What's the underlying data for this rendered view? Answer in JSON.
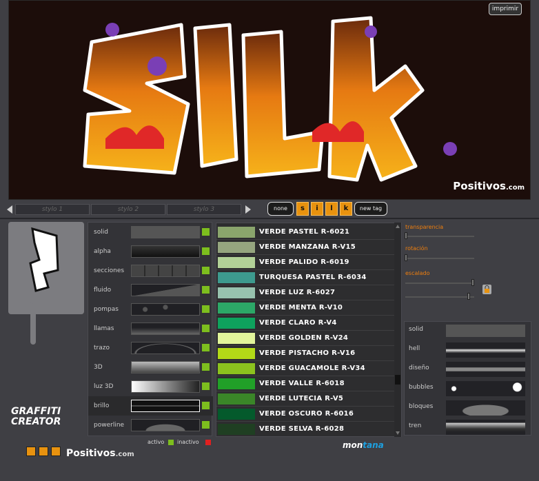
{
  "canvas": {
    "print_label": "imprimir",
    "watermark": "Positivos",
    "watermark_suffix": ".com"
  },
  "style_bar": {
    "slots": [
      "stylo 1",
      "stylo 2",
      "stylo 3"
    ],
    "none_label": "none",
    "letters": [
      "s",
      "i",
      "l",
      "k"
    ],
    "new_tag_label": "new tag"
  },
  "effects": {
    "items": [
      "solid",
      "alpha",
      "secciones",
      "fluido",
      "pompas",
      "llamas",
      "trazo",
      "3D",
      "luz 3D",
      "brillo",
      "powerline"
    ],
    "legend_active": "activo",
    "legend_inactive": "inactivo",
    "active_color": "#7dbe1e",
    "inactive_color": "#e02020"
  },
  "colors": {
    "items": [
      {
        "name": "VERDE PASTEL R-6021",
        "hex": "#8aa56c"
      },
      {
        "name": "VERDE MANZANA R-V15",
        "hex": "#95a57f"
      },
      {
        "name": "VERDE PALIDO R-6019",
        "hex": "#b2d197"
      },
      {
        "name": "TURQUESA PASTEL R-6034",
        "hex": "#3d9a8e"
      },
      {
        "name": "VERDE LUZ R-6027",
        "hex": "#97c2ae"
      },
      {
        "name": "VERDE MENTA R-V10",
        "hex": "#2ca867"
      },
      {
        "name": "VERDE CLARO R-V4",
        "hex": "#0ea25d"
      },
      {
        "name": "VERDE GOLDEN R-V24",
        "hex": "#e2f59b"
      },
      {
        "name": "VERDE PISTACHO R-V16",
        "hex": "#b3da17"
      },
      {
        "name": "VERDE GUACAMOLE R-V34",
        "hex": "#8cc21e"
      },
      {
        "name": "VERDE VALLE R-6018",
        "hex": "#21a028"
      },
      {
        "name": "VERDE LUTECIA R-V5",
        "hex": "#3a8628"
      },
      {
        "name": "VERDE OSCURO R-6016",
        "hex": "#045a2c"
      },
      {
        "name": "VERDE SELVA R-6028",
        "hex": "#1f3f22"
      }
    ]
  },
  "controls": {
    "transparency_label": "transparencia",
    "rotation_label": "rotación",
    "scale_label": "escalado"
  },
  "fills": {
    "items": [
      "solid",
      "hell",
      "diseño",
      "bubbles",
      "bloques",
      "tren"
    ]
  },
  "branding": {
    "logo_line1": "GRAFFITI",
    "logo_line2": "CREATOR",
    "positivos": "Positivos",
    "positivos_suffix": ".com",
    "montana_a": "mon",
    "montana_b": "tana"
  }
}
